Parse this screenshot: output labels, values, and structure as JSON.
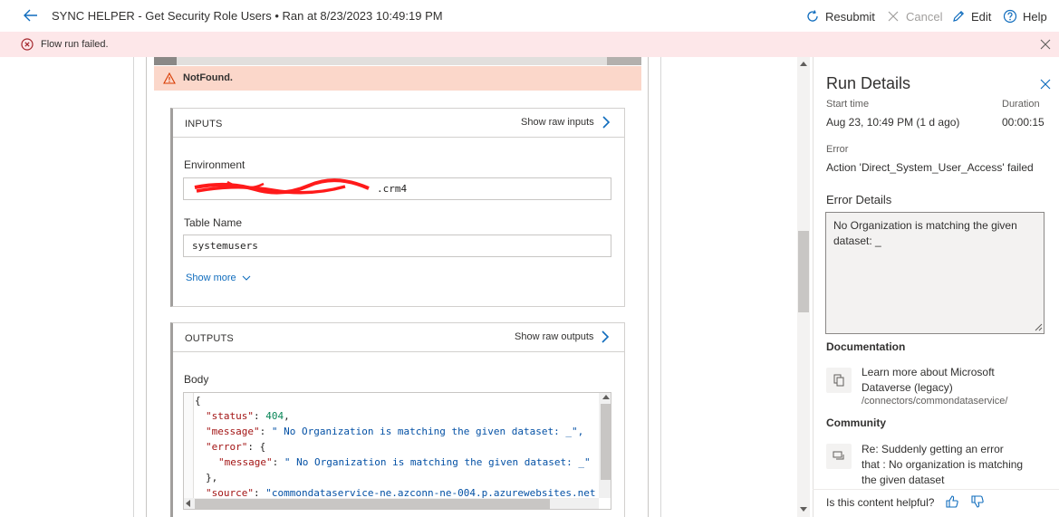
{
  "header": {
    "title": "SYNC HELPER - Get Security Role Users • Ran at 8/23/2023 10:49:19 PM",
    "actions": {
      "resubmit": "Resubmit",
      "cancel": "Cancel",
      "edit": "Edit",
      "help": "Help"
    }
  },
  "banner": {
    "message": "Flow run failed."
  },
  "action_card": {
    "status": "NotFound.",
    "inputs": {
      "title": "INPUTS",
      "raw_link": "Show raw inputs",
      "environment_label": "Environment",
      "environment_value": ".crm4",
      "table_label": "Table Name",
      "table_value": "systemusers",
      "show_more": "Show more"
    },
    "outputs": {
      "title": "OUTPUTS",
      "raw_link": "Show raw outputs",
      "body_label": "Body",
      "code": {
        "open_brace": "{",
        "status_key": "\"status\"",
        "status_value": "404",
        "message_key": "\"message\"",
        "message_value": "\" No Organization is matching the given dataset: _\",",
        "error_key": "\"error\"",
        "error_open": ": {",
        "inner_message_key": "\"message\"",
        "inner_message_value": "\" No Organization is matching the given dataset: _\"",
        "error_close": "},",
        "source_key": "\"source\"",
        "source_value": "\"commondataservice-ne.azconn-ne-004.p.azurewebsites.net"
      }
    }
  },
  "run_details": {
    "title": "Run Details",
    "start_time_label": "Start time",
    "start_time_value": "Aug 23, 10:49 PM (1 d ago)",
    "duration_label": "Duration",
    "duration_value": "00:00:15",
    "error_label": "Error",
    "error_value": "Action 'Direct_System_User_Access' failed",
    "error_details_label": "Error Details",
    "error_details_text": "No Organization is matching the given dataset: _",
    "documentation_label": "Documentation",
    "doc_link": "Learn more about Microsoft Dataverse (legacy)",
    "doc_path": "/connectors/commondataservice/",
    "community_label": "Community",
    "community_link": "Re: Suddenly getting an error that : No organization is matching the given dataset",
    "helpful_question": "Is this content helpful?"
  }
}
